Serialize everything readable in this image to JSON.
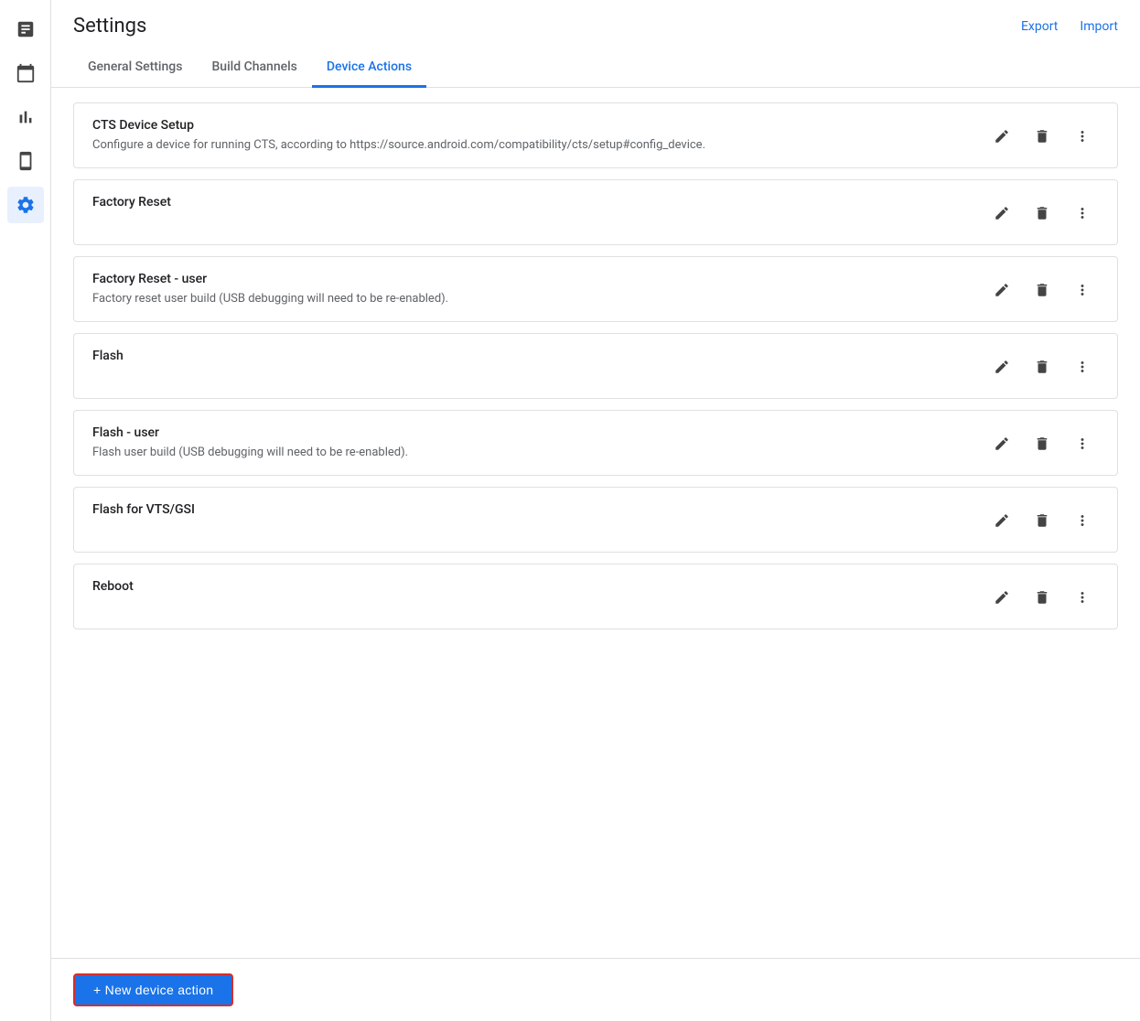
{
  "header": {
    "title": "Settings",
    "export_label": "Export",
    "import_label": "Import"
  },
  "tabs": [
    {
      "id": "general",
      "label": "General Settings",
      "active": false
    },
    {
      "id": "build_channels",
      "label": "Build Channels",
      "active": false
    },
    {
      "id": "device_actions",
      "label": "Device Actions",
      "active": true
    }
  ],
  "sidebar": {
    "items": [
      {
        "id": "reports",
        "icon": "reports-icon"
      },
      {
        "id": "calendar",
        "icon": "calendar-icon"
      },
      {
        "id": "charts",
        "icon": "charts-icon"
      },
      {
        "id": "device",
        "icon": "device-icon"
      },
      {
        "id": "settings",
        "icon": "settings-icon",
        "active": true
      }
    ]
  },
  "device_actions": [
    {
      "id": "cts_device_setup",
      "title": "CTS Device Setup",
      "description": "Configure a device for running CTS, according to https://source.android.com/compatibility/cts/setup#config_device."
    },
    {
      "id": "factory_reset",
      "title": "Factory Reset",
      "description": ""
    },
    {
      "id": "factory_reset_user",
      "title": "Factory Reset - user",
      "description": "Factory reset user build (USB debugging will need to be re-enabled)."
    },
    {
      "id": "flash",
      "title": "Flash",
      "description": ""
    },
    {
      "id": "flash_user",
      "title": "Flash - user",
      "description": "Flash user build (USB debugging will need to be re-enabled)."
    },
    {
      "id": "flash_vts_gsi",
      "title": "Flash for VTS/GSI",
      "description": ""
    },
    {
      "id": "reboot",
      "title": "Reboot",
      "description": ""
    }
  ],
  "footer": {
    "new_action_label": "+ New device action"
  }
}
